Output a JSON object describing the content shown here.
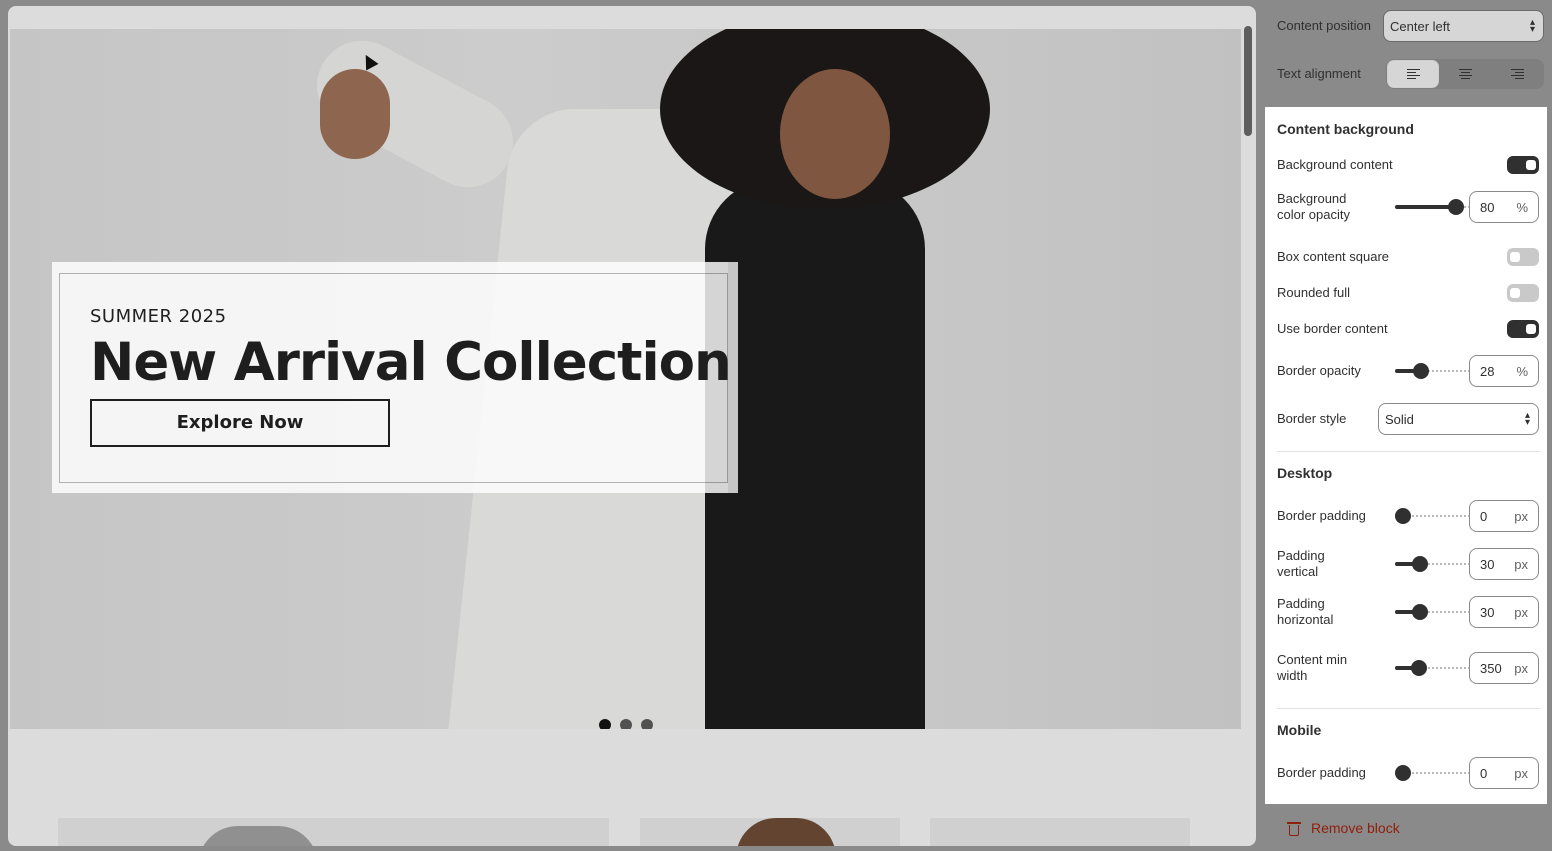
{
  "preview": {
    "hero": {
      "eyebrow": "SUMMER 2025",
      "headline": "New Arrival Collection",
      "cta_label": "Explore Now",
      "slides": 3,
      "active_slide": 1
    }
  },
  "panel": {
    "content_position": {
      "label": "Content position",
      "value": "Center left"
    },
    "text_alignment": {
      "label": "Text alignment",
      "options": [
        "left-align-icon",
        "center-align-icon",
        "right-align-icon"
      ],
      "selected": "left"
    },
    "content_background": {
      "title": "Content background",
      "background_content": {
        "label": "Background content",
        "on": true
      },
      "bg_opacity": {
        "label": "Background color opacity",
        "value": "80",
        "unit": "%",
        "level": 0.8
      },
      "box_square": {
        "label": "Box content square",
        "on": false
      },
      "rounded_full": {
        "label": "Rounded full",
        "on": false
      },
      "use_border": {
        "label": "Use border content",
        "on": true
      },
      "border_opacity": {
        "label": "Border opacity",
        "value": "28",
        "unit": "%",
        "level": 0.28
      },
      "border_style": {
        "label": "Border style",
        "value": "Solid"
      }
    },
    "desktop": {
      "title": "Desktop",
      "border_padding": {
        "label": "Border padding",
        "value": "0",
        "unit": "px",
        "level": 0
      },
      "padding_vertical": {
        "label": "Padding vertical",
        "value": "30",
        "unit": "px",
        "level": 0.25
      },
      "padding_horizontal": {
        "label": "Padding horizontal",
        "value": "30",
        "unit": "px",
        "level": 0.25
      },
      "content_min_width": {
        "label": "Content min width",
        "value": "350",
        "unit": "px",
        "level": 0.24
      }
    },
    "mobile": {
      "title": "Mobile",
      "border_padding": {
        "label": "Border padding",
        "value": "0",
        "unit": "px",
        "level": 0
      }
    },
    "remove_label": "Remove block"
  },
  "colors": {
    "panel_text": "#303030",
    "remove": "#8e1f0b",
    "toggle_on": "#303030"
  }
}
